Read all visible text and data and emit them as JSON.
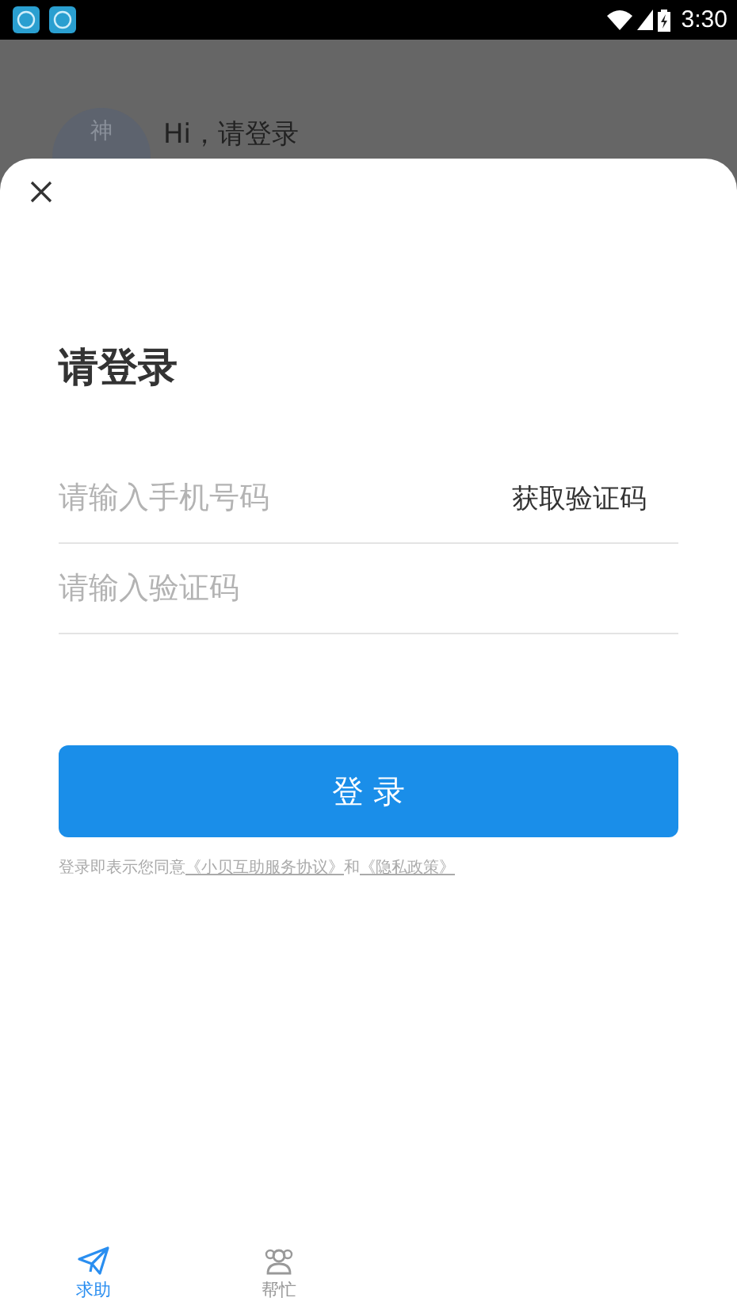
{
  "status_bar": {
    "time": "3:30"
  },
  "background": {
    "avatar_text": "神",
    "greeting": "Hi，请登录"
  },
  "sheet": {
    "title": "请登录",
    "phone_field": {
      "placeholder": "请输入手机号码"
    },
    "code_button": "获取验证码",
    "code_field": {
      "placeholder": "请输入验证码"
    },
    "login_button": "登 录",
    "agreement": {
      "prefix": "登录即表示您同意",
      "terms_link": "《小贝互助服务协议》",
      "and": "和",
      "privacy_link": "《隐私政策》"
    }
  },
  "bottom_nav": [
    {
      "label": "求助",
      "kind": "send",
      "selected": true
    },
    {
      "label": "帮忙",
      "kind": "people",
      "selected": false
    }
  ]
}
